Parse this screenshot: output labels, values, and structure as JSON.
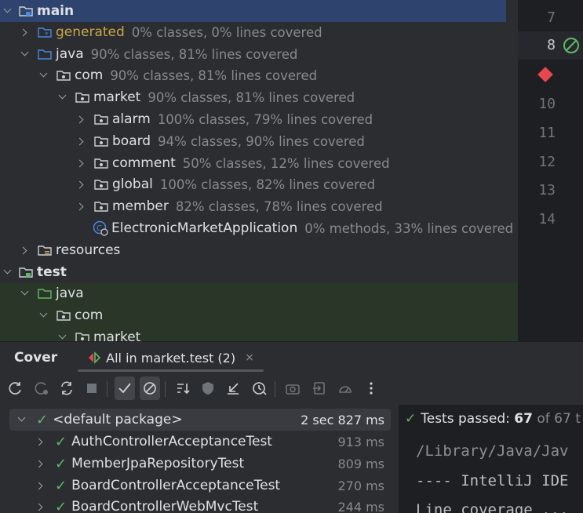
{
  "tree": [
    {
      "name": "main",
      "cov": "",
      "bold": true,
      "expanded": true,
      "sel": true
    },
    {
      "name": "generated",
      "cov": "0% classes, 0% lines covered"
    },
    {
      "name": "java",
      "cov": "90% classes, 81% lines covered"
    },
    {
      "name": "com",
      "cov": "90% classes, 81% lines covered"
    },
    {
      "name": "market",
      "cov": "90% classes, 81% lines covered"
    },
    {
      "name": "alarm",
      "cov": "100% classes, 79% lines covered"
    },
    {
      "name": "board",
      "cov": "94% classes, 90% lines covered"
    },
    {
      "name": "comment",
      "cov": "50% classes, 12% lines covered"
    },
    {
      "name": "global",
      "cov": "100% classes, 82% lines covered"
    },
    {
      "name": "member",
      "cov": "82% classes, 78% lines covered"
    },
    {
      "name": "ElectronicMarketApplication",
      "cov": "0% methods, 33% lines covered"
    },
    {
      "name": "resources",
      "cov": ""
    },
    {
      "name": "test",
      "cov": ""
    },
    {
      "name": "java",
      "cov": ""
    },
    {
      "name": "com",
      "cov": ""
    },
    {
      "name": "market",
      "cov": ""
    }
  ],
  "gutter": {
    "lines": [
      "7",
      "8",
      "",
      "10",
      "11",
      "12",
      "13",
      "14"
    ]
  },
  "toolwindow": {
    "title": "Cover",
    "tab_label": "All in market.test (2)",
    "close": "×"
  },
  "results": [
    {
      "name": "<default package>",
      "time": "2 sec 827 ms"
    },
    {
      "name": "AuthControllerAcceptanceTest",
      "time": "913 ms"
    },
    {
      "name": "MemberJpaRepositoryTest",
      "time": "809 ms"
    },
    {
      "name": "BoardControllerAcceptanceTest",
      "time": "270 ms"
    },
    {
      "name": "BoardControllerWebMvcTest",
      "time": "244 ms"
    }
  ],
  "console": {
    "passed_label": "Tests passed:",
    "passed_count": "67",
    "passed_of": "of 67 t",
    "line1": "/Library/Java/Jav",
    "line2": "---- IntelliJ IDE",
    "line3": "Line coverage ..."
  },
  "colors": {
    "accent": "#2e436e",
    "pass": "#5fb865",
    "breakpoint": "#e5484d",
    "generated": "#c7a84a"
  }
}
